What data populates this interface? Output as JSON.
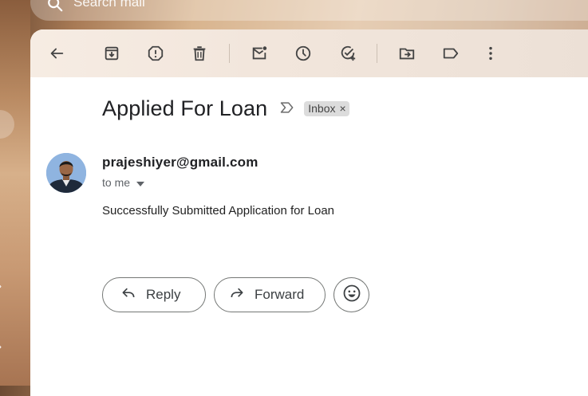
{
  "search": {
    "placeholder": "Search mail"
  },
  "toolbar": {
    "items": [
      {
        "name": "back-arrow-icon"
      },
      {
        "name": "archive-icon"
      },
      {
        "name": "report-spam-icon"
      },
      {
        "name": "delete-icon"
      },
      {
        "name": "mark-unread-icon"
      },
      {
        "name": "snooze-icon"
      },
      {
        "name": "add-task-icon"
      },
      {
        "name": "move-to-icon"
      },
      {
        "name": "label-icon"
      },
      {
        "name": "more-vert-icon"
      }
    ]
  },
  "email": {
    "subject": "Applied For Loan",
    "label_chip": "Inbox",
    "label_close": "×",
    "sender": "prajeshiyer@gmail.com",
    "recipient": "to me",
    "body": "Successfully Submitted Application for Loan"
  },
  "actions": {
    "reply_label": "Reply",
    "forward_label": "Forward"
  },
  "colors": {
    "text_primary": "#202124",
    "text_secondary": "#5f6368",
    "button_border": "#747775",
    "chip_bg": "#dcdcdc"
  }
}
